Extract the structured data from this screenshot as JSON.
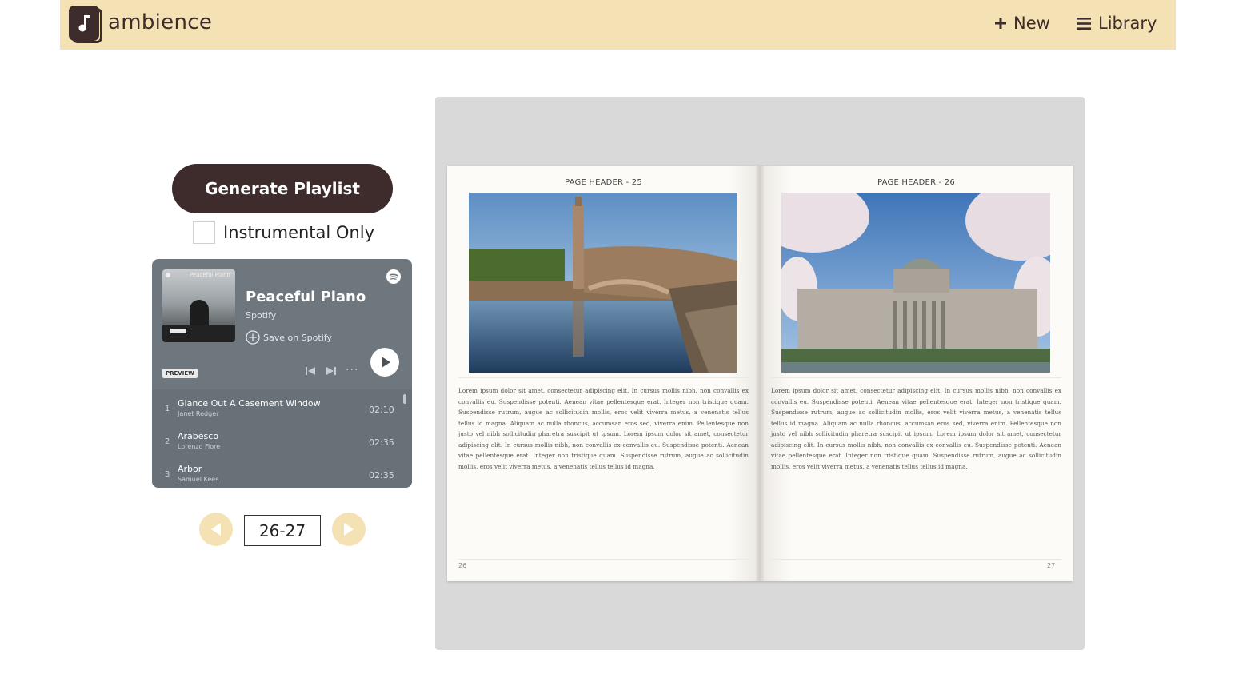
{
  "app": {
    "brand": "ambience",
    "nav": {
      "new_label": "New",
      "library_label": "Library"
    }
  },
  "controls": {
    "generate_label": "Generate Playlist",
    "instrumental_label": "Instrumental Only",
    "instrumental_checked": false
  },
  "spotify": {
    "cover_title": "Peaceful Piano",
    "title": "Peaceful Piano",
    "subtitle": "Spotify",
    "save_label": "Save on Spotify",
    "preview_badge": "PREVIEW",
    "tracks": [
      {
        "num": "1",
        "name": "Glance Out A Casement Window",
        "artist": "Janet Redger",
        "duration": "02:10"
      },
      {
        "num": "2",
        "name": "Arabesco",
        "artist": "Lorenzo Fiore",
        "duration": "02:35"
      },
      {
        "num": "3",
        "name": "Arbor",
        "artist": "Samuel Kees",
        "duration": "02:35"
      }
    ]
  },
  "pagination": {
    "page_range": "26-27"
  },
  "book": {
    "left": {
      "header": "PAGE HEADER - 25",
      "body": "Lorem ipsum dolor sit amet, consectetur adipiscing elit. In cursus mollis nibh, non convallis ex convallis eu. Suspendisse potenti. Aenean vitae pellentesque erat. Integer non tristique quam. Suspendisse rutrum, augue ac sollicitudin mollis, eros velit viverra metus, a venenatis tellus tellus id magna. Aliquam ac nulla rhoncus, accumsan eros sed, viverra enim. Pellentesque non justo vel nibh sollicitudin pharetra suscipit ut ipsum. Lorem ipsum dolor sit amet, consectetur adipiscing elit. In cursus mollis nibh, non convallis ex convallis eu. Suspendisse potenti. Aenean vitae pellentesque erat. Integer non tristique quam. Suspendisse rutrum, augue ac sollicitudin mollis, eros velit viverra metus, a venenatis tellus tellus id magna.",
      "page_number": "26"
    },
    "right": {
      "header": "PAGE HEADER - 26",
      "body": "Lorem ipsum dolor sit amet, consectetur adipiscing elit. In cursus mollis nibh, non convallis ex convallis eu. Suspendisse potenti. Aenean vitae pellentesque erat. Integer non tristique quam. Suspendisse rutrum, augue ac sollicitudin mollis, eros velit viverra metus, a venenatis tellus tellus id magna. Aliquam ac nulla rhoncus, accumsan eros sed, viverra enim. Pellentesque non justo vel nibh sollicitudin pharetra suscipit ut ipsum. Lorem ipsum dolor sit amet, consectetur adipiscing elit. In cursus mollis nibh, non convallis ex convallis eu. Suspendisse potenti. Aenean vitae pellentesque erat. Integer non tristique quam. Suspendisse rutrum, augue ac sollicitudin mollis, eros velit viverra metus, a venenatis tellus tellus id magna.",
      "page_number": "27"
    }
  },
  "icons": {
    "logo": "music-note-book-icon",
    "new": "plus-icon",
    "library": "menu-icon",
    "spotify": "spotify-logo-icon",
    "save": "add-circle-icon",
    "prev_track": "skip-back-icon",
    "next_track": "skip-forward-icon",
    "more": "more-icon",
    "play": "play-icon",
    "prev_page": "arrow-left-icon",
    "next_page": "arrow-right-icon"
  },
  "colors": {
    "accent": "#3e2b2c",
    "header_bg": "#f5e2b4",
    "viewer_bg": "#d9d9d9",
    "spotify_bg": "#6e777d"
  }
}
